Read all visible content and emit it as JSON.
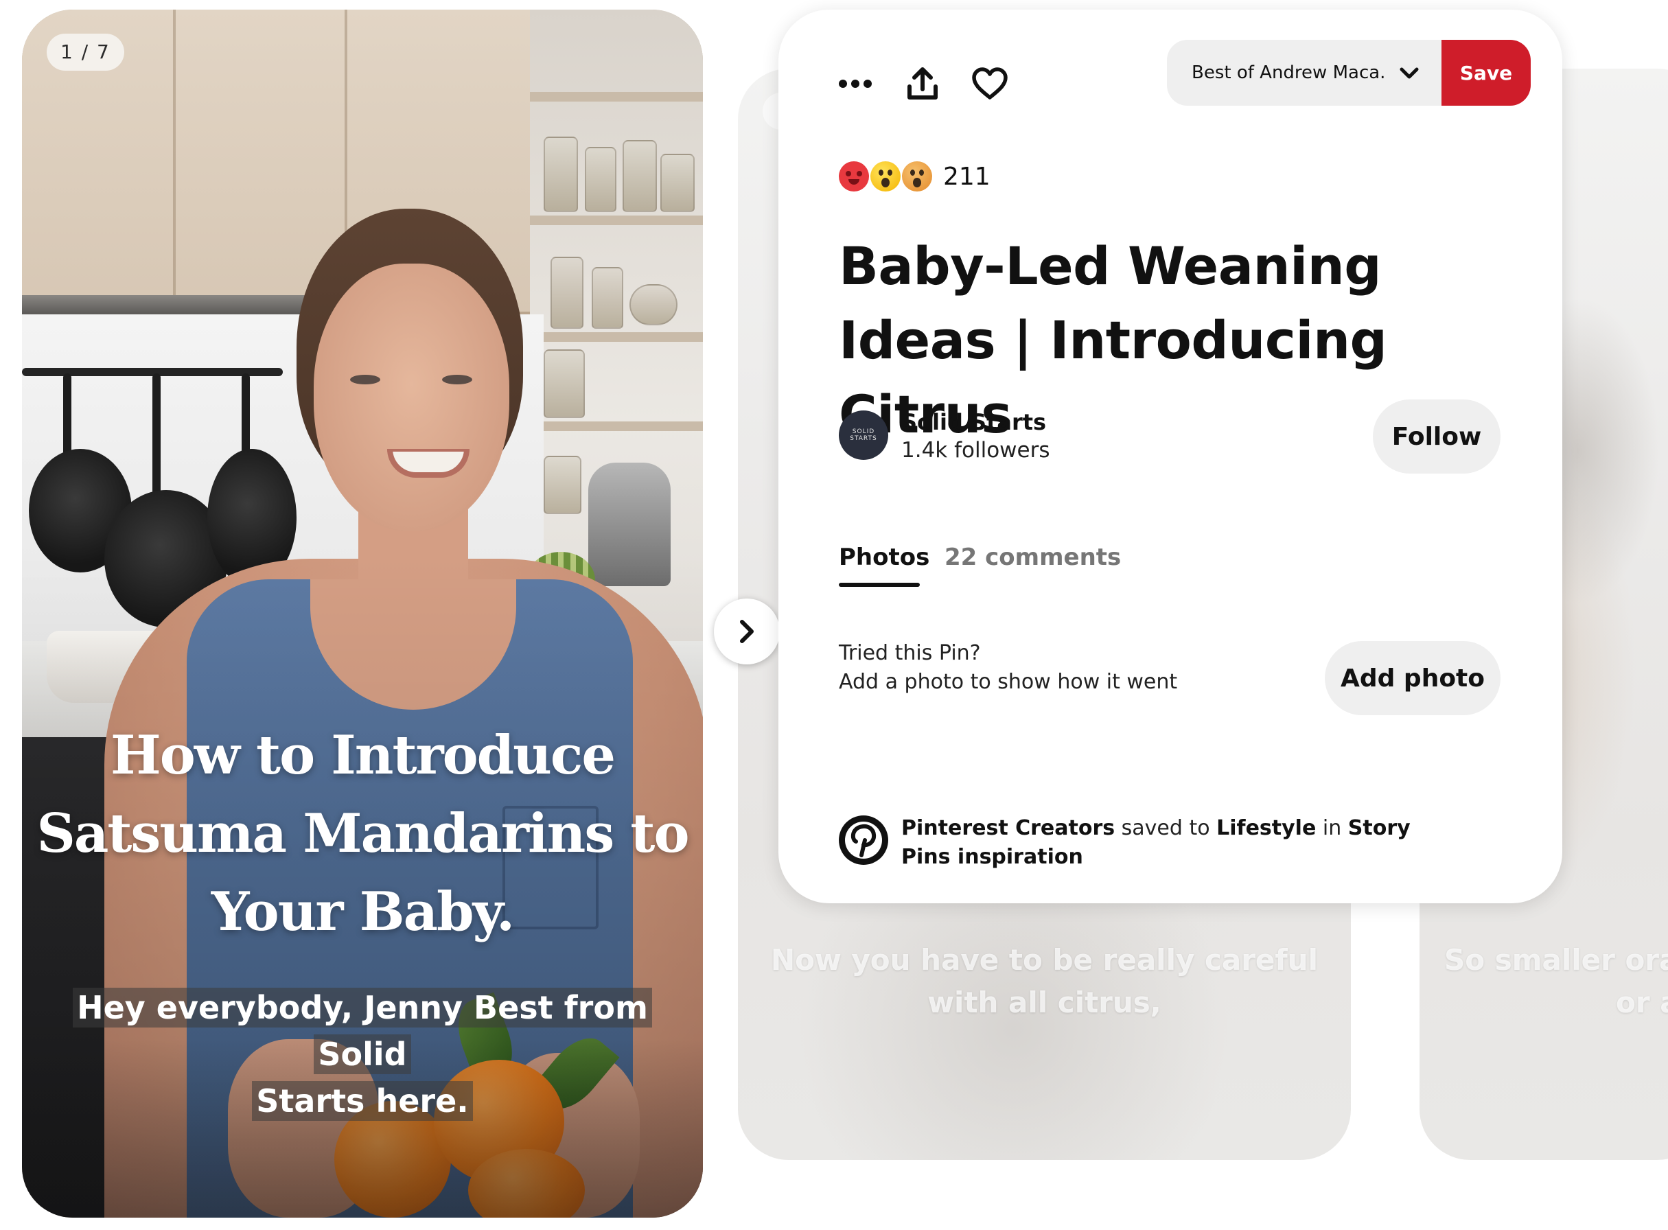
{
  "story": {
    "page_indicator": "1 / 7",
    "title_line1": "How to Introduce",
    "title_line2": "Satsuma Mandarins to",
    "title_line3": "Your Baby.",
    "caption_line1": "Hey everybody, Jenny Best from Solid",
    "caption_line2": "Starts here."
  },
  "background_pages": [
    {
      "caption": "Now you have to be really careful with all citrus,"
    },
    {
      "caption_line1": "So smaller oran",
      "caption_line2": "or a"
    }
  ],
  "toolbar": {
    "more_icon": "more-options-icon",
    "share_icon": "share-icon",
    "like_icon": "heart-icon",
    "board_name": "Best of Andrew Maca...",
    "save_label": "Save",
    "save_color": "#cf1d2a"
  },
  "reactions": {
    "emojis": [
      "heart-eyes",
      "wow",
      "surprised"
    ],
    "count": "211"
  },
  "pin": {
    "title": "Baby-Led Weaning Ideas | Introducing Citrus"
  },
  "creator": {
    "avatar_text": "SOLID STARTS",
    "name": "Solid Starts",
    "followers": "1.4k followers",
    "follow_label": "Follow"
  },
  "tabs": [
    {
      "label": "Photos",
      "active": true
    },
    {
      "label": "22 comments",
      "active": false
    }
  ],
  "tried": {
    "question": "Tried this Pin?",
    "prompt": "Add a photo to show how it went",
    "button_label": "Add photo"
  },
  "saved_by": {
    "user": "Pinterest Creators",
    "saved_to_text": "saved to",
    "board": "Lifestyle",
    "in_text": "in",
    "section": "Story Pins inspiration"
  }
}
